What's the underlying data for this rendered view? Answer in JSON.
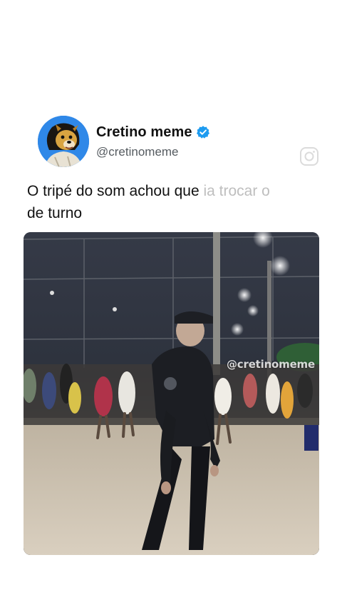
{
  "post": {
    "author": {
      "display_name": "Cretino meme",
      "handle": "@cretinomeme",
      "verified": true,
      "avatar_icon": "dog-avatar-icon",
      "verified_icon": "verified-badge-icon"
    },
    "caption_main": "O tripé do som achou que ",
    "caption_faded": "ia trocar",
    "caption_faded_tail": " o",
    "caption_line2": "de turno",
    "video": {
      "watermark": "@cretinomeme",
      "scene": "night-plaza-dance"
    },
    "watermark_icon": "instagram-icon"
  },
  "colors": {
    "verified_blue": "#1d9bf0",
    "avatar_bg": "#2f88e8"
  }
}
